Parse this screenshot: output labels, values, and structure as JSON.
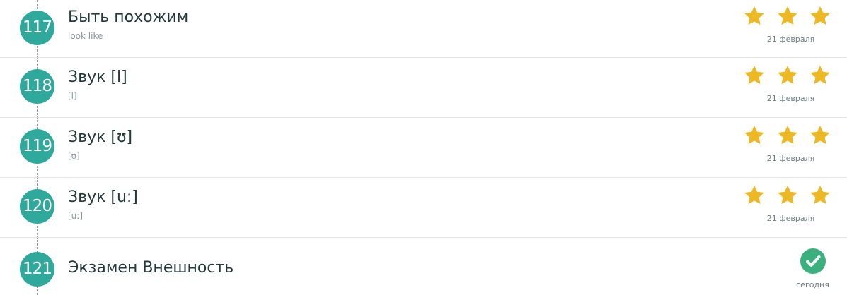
{
  "colors": {
    "badge": "#2fa99b",
    "star": "#ecb924",
    "check": "#3ab07e",
    "title": "#243a3a"
  },
  "lessons": [
    {
      "number": "117",
      "title": "Быть похожим",
      "subtitle": "look like",
      "stars": 3,
      "date": "21 февраля"
    },
    {
      "number": "118",
      "title": "Звук [l]",
      "subtitle": "[l]",
      "stars": 3,
      "date": "21 февраля"
    },
    {
      "number": "119",
      "title": "Звук [ʊ]",
      "subtitle": "[ʊ]",
      "stars": 3,
      "date": "21 февраля"
    },
    {
      "number": "120",
      "title": "Звук [u:]",
      "subtitle": "[u:]",
      "stars": 3,
      "date": "21 февраля"
    },
    {
      "number": "121",
      "title": "Экзамен Внешность",
      "status_icon": "check-circle-icon",
      "date": "сегодня"
    }
  ]
}
